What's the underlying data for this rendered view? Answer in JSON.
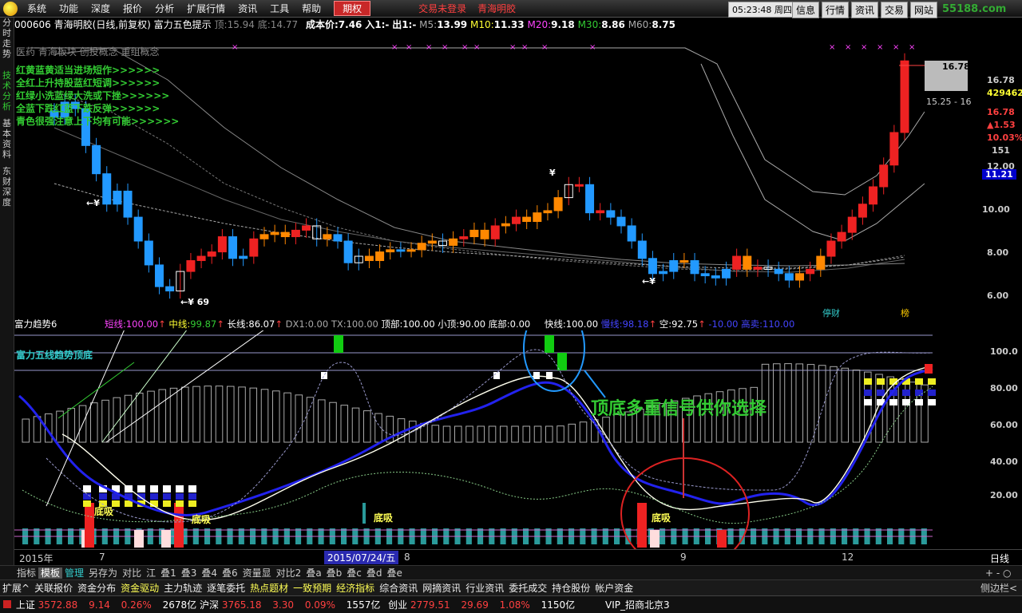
{
  "menu": {
    "items": [
      "系统",
      "功能",
      "深度",
      "报价",
      "分析",
      "扩展行情",
      "资讯",
      "工具",
      "帮助"
    ],
    "active": "期权",
    "login": "交易未登录",
    "broker": "青海明胶",
    "clock": "05:23:48",
    "weekday": "周四",
    "right_buttons": [
      "信息",
      "行情",
      "资讯",
      "交易",
      "网站"
    ],
    "brand": "55188.com"
  },
  "left_tabs": {
    "tab1": "分时走势",
    "tab2": "技术分析",
    "tab3": "基本资料",
    "tab4": "东财深度"
  },
  "title": {
    "code": "000606",
    "name": "青海明胶",
    "period": "(日线,前复权)",
    "indicator": "富力五色提示",
    "hi_label": "顶:",
    "hi_val": "15.94",
    "lo_label": "底:",
    "lo_val": "14.77",
    "cost_label": "成本价:",
    "cost_val": "7.46",
    "in_label": "入1:",
    "in_val": "-",
    "out_label": "出1:",
    "out_val": "-",
    "ma": [
      {
        "label": "M5:",
        "val": "13.99"
      },
      {
        "label": "M10:",
        "val": "11.33"
      },
      {
        "label": "M20:",
        "val": "9.18"
      },
      {
        "label": "M30:",
        "val": "8.86"
      },
      {
        "label": "M60:",
        "val": "8.75"
      }
    ]
  },
  "concepts": "医药 青海板块 创投概念 重组概念",
  "tips": [
    "红黄蓝黄适当进场短作>>>>>>",
    "全红上升持股蓝红短调>>>>>>",
    "红绿小洗蓝绿大洗或下挫>>>>>>",
    "全蓝下跌红蓝下跌反弹>>>>>>",
    "青色很强注意上下均有可能>>>>>>"
  ],
  "price_axis": {
    "labels": [
      "16.78",
      "12.00",
      "10.00",
      "8.00",
      "6.00"
    ],
    "cur_box": "16.78",
    "cur_range": "15.25 - 16",
    "info": [
      {
        "t": "16.78",
        "c": "wht"
      },
      {
        "t": "429462",
        "c": "yel"
      },
      {
        "t": "16.78",
        "c": "red"
      },
      {
        "t": "▲1.53",
        "c": "red"
      },
      {
        "t": "10.03%",
        "c": "red"
      },
      {
        "t": "151",
        "c": "wht"
      },
      {
        "t": "12.00",
        "c": "wht"
      },
      {
        "t": "11.21",
        "c": "hl"
      }
    ]
  },
  "annot": {
    "k1": "←¥",
    "k2": "←¥ 69",
    "k3": "¥",
    "k4": "←¥",
    "tag1": "停财",
    "tag2": "榜"
  },
  "indicator": {
    "name": "富力趋势6",
    "short_l": "短线:",
    "short_v": "100.00",
    "mid_l": "中线:",
    "mid_v": "99.87",
    "long_l": "长线:",
    "long_v": "86.07",
    "dx_l": "DX1:",
    "dx_v": "0.00",
    "tx_l": "TX:",
    "tx_v": "100.00",
    "top_l": "顶部:",
    "top_v": "100.00",
    "sm_l": "小顶:",
    "sm_v": "90.00",
    "bot_l": "底部:",
    "bot_v": "0.00",
    "fast_l": "快线:",
    "fast_v": "100.00",
    "slow_l": "慢线:",
    "slow_v": "98.18",
    "empty_l": "空:",
    "empty_v": "92.75",
    "neg_v": "-10.00",
    "hs_l": "高卖:",
    "hs_v": "110.00",
    "subtitle": "富力五线趋势顶底",
    "levels": [
      "100.0",
      "80.00",
      "60.00",
      "40.00",
      "20.00"
    ],
    "dixi": "底吸",
    "callout": "顶底多重信号供你选择"
  },
  "xaxis": {
    "year": "2015年",
    "m7": "7",
    "date": "2015/07/24/五",
    "m8": "8",
    "m9": "9",
    "m12": "12",
    "period": "日线"
  },
  "toolbar1": [
    "指标",
    "模板",
    "管理",
    "另存为",
    "对比",
    "江",
    "叠1",
    "叠3",
    "叠4",
    "叠6",
    "资量显",
    "对比2",
    "叠a",
    "叠b",
    "叠c",
    "叠d",
    "叠e"
  ],
  "toolbar1_sel": "模板",
  "toolbar1_right": "+ - ○",
  "toolbar2": [
    "扩展^",
    "关联报价",
    "资金分布",
    "资金驱动",
    "主力轨迹",
    "逐笔委托",
    "热点题材",
    "一致预期",
    "经济指标",
    "综合资讯",
    "网摘资讯",
    "行业资讯",
    "委托成交",
    "持仓股份",
    "帐户资金"
  ],
  "toolbar2_right": "侧边栏<",
  "status": {
    "sh_l": "上证",
    "sh_v": "3572.88",
    "sh_c": "9.14",
    "sh_p": "0.26%",
    "sh_a": "2678亿",
    "hs_l": "沪深",
    "hs_v": "3765.18",
    "hs_c": "3.30",
    "hs_p": "0.09%",
    "hs_a": "1557亿",
    "cy_l": "创业",
    "cy_v": "2779.51",
    "cy_c": "29.69",
    "cy_p": "1.08%",
    "cy_a": "1150亿",
    "vip": "VIP_招商北京3"
  }
}
